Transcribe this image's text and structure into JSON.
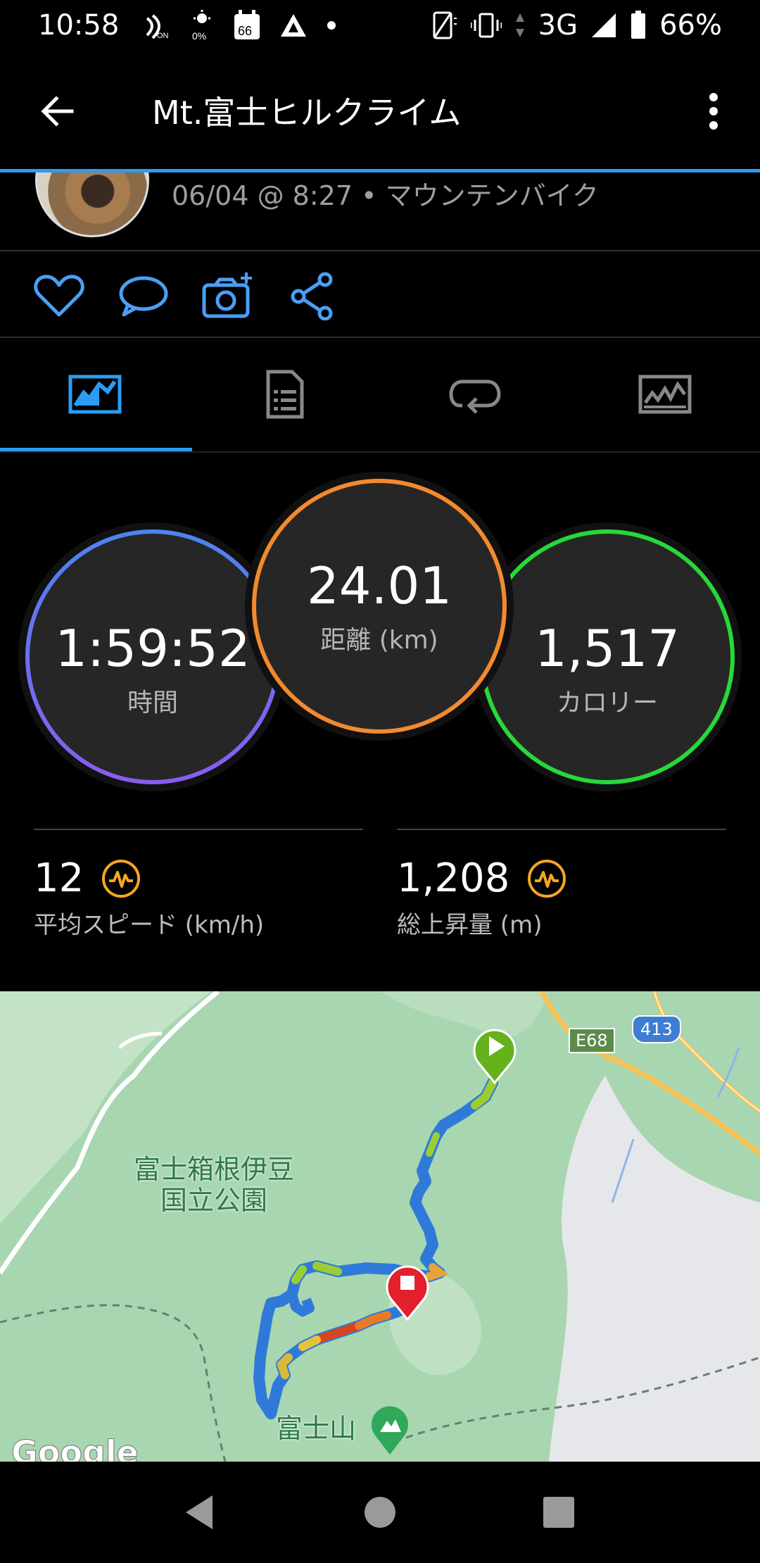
{
  "status_bar": {
    "time": "10:58",
    "network": "3G",
    "battery": "66%",
    "icons": [
      "nfc-on-icon",
      "brightness-icon",
      "calendar-icon",
      "app-notification-icon",
      "dot-icon",
      "no-sim-icon",
      "vibrate-icon",
      "data-arrows-icon",
      "signal-icon",
      "battery-icon"
    ],
    "brightness_label": "0%",
    "calendar_day": "66"
  },
  "app_bar": {
    "title": "Mt.富士ヒルクライム"
  },
  "activity": {
    "meta": "06/04 @ 8:27 • マウンテンバイク"
  },
  "actions": [
    "like-button",
    "comment-button",
    "add-photo-button",
    "share-button"
  ],
  "tabs": [
    "overview",
    "details",
    "laps",
    "charts"
  ],
  "stats": {
    "time": {
      "value": "1:59:52",
      "label": "時間"
    },
    "distance": {
      "value": "24.01",
      "label": "距離 (km)"
    },
    "calories": {
      "value": "1,517",
      "label": "カロリー"
    },
    "avg_speed": {
      "value": "12",
      "label": "平均スピード (km/h)"
    },
    "elevation_gain": {
      "value": "1,208",
      "label": "総上昇量 (m)"
    }
  },
  "map": {
    "park_label_line1": "富士箱根伊豆",
    "park_label_line2": "国立公園",
    "mountain_label": "富士山",
    "road_e68": "E68",
    "road_413": "413",
    "attribution": "Google"
  },
  "colors": {
    "accent": "#2b9cf2",
    "time_ring": "#6c6ef0",
    "distance_ring": "#f28a2e",
    "calories_ring": "#27d83a",
    "badge": "#f5a623"
  }
}
